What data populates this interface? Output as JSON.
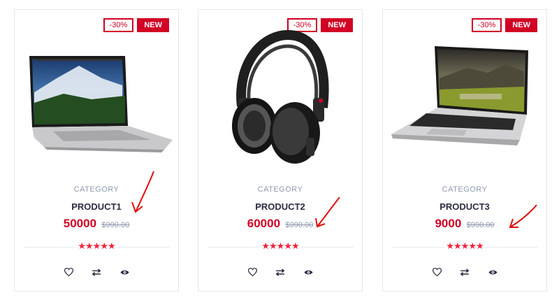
{
  "colors": {
    "accent": "#d10024",
    "star": "#ef233c",
    "muted": "#8d99ae",
    "dark": "#2b2d42"
  },
  "products": [
    {
      "sale": "-30%",
      "new": "NEW",
      "category": "CATEGORY",
      "name": "PRODUCT1",
      "price": "50000",
      "old_price": "$990.00",
      "rating": "★★★★★",
      "image": "laptop-image"
    },
    {
      "sale": "-30%",
      "new": "NEW",
      "category": "CATEGORY",
      "name": "PRODUCT2",
      "price": "60000",
      "old_price": "$990.00",
      "rating": "★★★★★",
      "image": "headphones-image"
    },
    {
      "sale": "-30%",
      "new": "NEW",
      "category": "CATEGORY",
      "name": "PRODUCT3",
      "price": "9000",
      "old_price": "$990.00",
      "rating": "★★★★★",
      "image": "laptop-image"
    }
  ],
  "actions": [
    "wishlist-icon",
    "compare-icon",
    "quick-view-icon"
  ]
}
